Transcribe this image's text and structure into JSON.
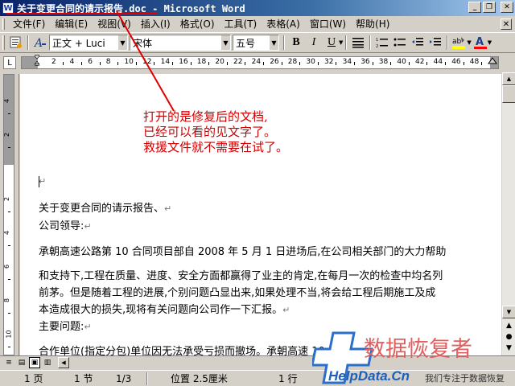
{
  "window": {
    "app_icon_letter": "W",
    "title": "关于变更合同的请示报告.doc - Microsoft Word",
    "controls": [
      "_",
      "❐",
      "✕"
    ]
  },
  "menu": {
    "items": [
      "文件(F)",
      "编辑(E)",
      "视图(V)",
      "插入(I)",
      "格式(O)",
      "工具(T)",
      "表格(A)",
      "窗口(W)",
      "帮助(H)"
    ],
    "close_doc": "✕"
  },
  "toolbar": {
    "style_value": "正文 + Luci",
    "font_value": "宋体",
    "size_value": "五号",
    "bold": "B",
    "italic": "I",
    "underline": "U",
    "highlight_color": "#ffff00",
    "font_color": "#ff0000"
  },
  "ruler": {
    "h_numbers": [
      "2",
      "4",
      "6",
      "8",
      "10",
      "12",
      "14",
      "16",
      "18",
      "20",
      "22",
      "24",
      "26",
      "28",
      "30",
      "32",
      "34",
      "36",
      "38",
      "40",
      "42",
      "44",
      "46",
      "48"
    ],
    "v_numbers": [
      "4",
      "2",
      "2",
      "4",
      "6",
      "8",
      "10"
    ]
  },
  "annotation": {
    "lines": [
      "打开的是修复后的文档,",
      "已经可以看的见文字了。",
      "救援文件就不需要在试了。"
    ],
    "color": "#d00000"
  },
  "document": {
    "lines": [
      {
        "text": "",
        "mark": "↵"
      },
      {
        "text": "关于变更合同的请示报告、",
        "mark": "↵"
      },
      {
        "text": "公司领导:",
        "mark": "↵"
      },
      {
        "text": "承朝高速公路第 10 合同项目部自 2008 年 5 月 1 日进场后,在公司相关部门的大力帮助",
        "mark": ""
      },
      {
        "text": "和支持下,工程在质量、进度、安全方面都赢得了业主的肯定,在每月一次的检查中均名列",
        "mark": ""
      },
      {
        "text": "前茅。但是随着工程的进展,个别问题凸显出来,如果处理不当,将会给工程后期施工及成",
        "mark": ""
      },
      {
        "text": "本造成很大的损失,现将有关问题向公司作一下汇报。",
        "mark": "↵"
      },
      {
        "text": "主要问题:",
        "mark": "↵"
      },
      {
        "text": "合作单位(指定分包)单位因无法承受亏损而撤场。承朝高速 10",
        "mark": ""
      }
    ]
  },
  "statusbar": {
    "page": "1 页",
    "section": "1 节",
    "page_of": "1/3",
    "position": "位置 2.5厘米",
    "line": "1 行"
  },
  "watermark": {
    "title": "数据恢复者",
    "site": "HelpData.Cn",
    "slogan": "我们专注于数据恢复"
  }
}
